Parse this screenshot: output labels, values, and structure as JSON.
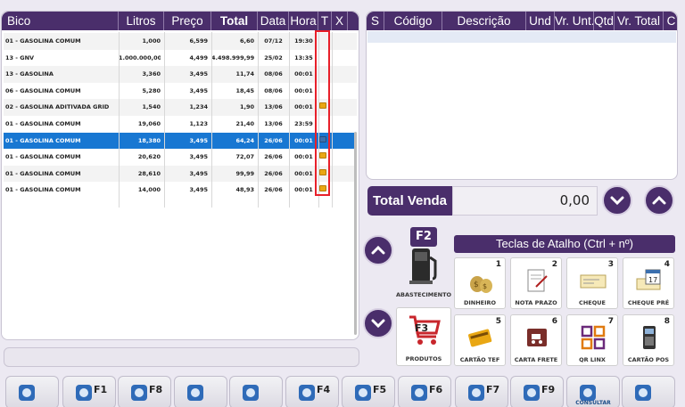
{
  "left_table": {
    "columns": [
      "Bico",
      "Litros",
      "Preço",
      "Total",
      "Data",
      "Hora",
      "T",
      "X"
    ],
    "rows": [
      {
        "bico": "01 - GASOLINA COMUM",
        "litros": "1,000",
        "preco": "6,599",
        "total": "6,60",
        "data": "07/12",
        "hora": "19:30",
        "icon": ""
      },
      {
        "bico": "13 - GNV",
        "litros": "1.000.000,000",
        "preco": "4,499",
        "total": "4.498.999,99",
        "data": "25/02",
        "hora": "13:35",
        "icon": ""
      },
      {
        "bico": "13 - GASOLINA",
        "litros": "3,360",
        "preco": "3,495",
        "total": "11,74",
        "data": "08/06",
        "hora": "00:01",
        "icon": ""
      },
      {
        "bico": "06 - GASOLINA COMUM",
        "litros": "5,280",
        "preco": "3,495",
        "total": "18,45",
        "data": "08/06",
        "hora": "00:01",
        "icon": ""
      },
      {
        "bico": "02 - GASOLINA ADITIVADA GRID",
        "litros": "1,540",
        "preco": "1,234",
        "total": "1,90",
        "data": "13/06",
        "hora": "00:01",
        "icon": "yellow"
      },
      {
        "bico": "01 - GASOLINA COMUM",
        "litros": "19,060",
        "preco": "1,123",
        "total": "21,40",
        "data": "13/06",
        "hora": "23:59",
        "icon": ""
      },
      {
        "bico": "01 - GASOLINA COMUM",
        "litros": "18,380",
        "preco": "3,495",
        "total": "64,24",
        "data": "26/06",
        "hora": "00:01",
        "icon": "blue",
        "selected": true
      },
      {
        "bico": "01 - GASOLINA COMUM",
        "litros": "20,620",
        "preco": "3,495",
        "total": "72,07",
        "data": "26/06",
        "hora": "00:01",
        "icon": "yellow"
      },
      {
        "bico": "01 - GASOLINA COMUM",
        "litros": "28,610",
        "preco": "3,495",
        "total": "99,99",
        "data": "26/06",
        "hora": "00:01",
        "icon": "yellow"
      },
      {
        "bico": "01 - GASOLINA COMUM",
        "litros": "14,000",
        "preco": "3,495",
        "total": "48,93",
        "data": "26/06",
        "hora": "00:01",
        "icon": "yellow"
      }
    ]
  },
  "right_table": {
    "columns": [
      "S",
      "Código",
      "Descrição",
      "Und",
      "Vr. Unt.",
      "Qtd",
      "Vr. Total",
      "C"
    ]
  },
  "total_venda": {
    "label": "Total Venda",
    "value": "0,00"
  },
  "shortcuts": {
    "title": "Teclas de Atalho (Ctrl + nº)",
    "f2_key": "F2",
    "f2_label": "ABASTECIMENTO",
    "f3_key": "F3",
    "f3_label": "PRODUTOS",
    "tiles": [
      {
        "num": "1",
        "label": "DINHEIRO",
        "icon": "money-bags-icon"
      },
      {
        "num": "2",
        "label": "NOTA PRAZO",
        "icon": "note-icon"
      },
      {
        "num": "3",
        "label": "CHEQUE",
        "icon": "cheque-icon"
      },
      {
        "num": "4",
        "label": "CHEQUE PRÉ",
        "icon": "calendar-cheque-icon"
      },
      {
        "num": "5",
        "label": "CARTÃO TEF",
        "icon": "card-icon"
      },
      {
        "num": "6",
        "label": "CARTA FRETE",
        "icon": "truck-icon"
      },
      {
        "num": "7",
        "label": "QR LINX",
        "icon": "qr-icon"
      },
      {
        "num": "8",
        "label": "CARTÃO POS",
        "icon": "pos-icon"
      }
    ]
  },
  "bottom_toolbar": [
    {
      "key": "",
      "caption": "",
      "icon": "fuel-nozzle-icon"
    },
    {
      "key": "F1",
      "caption": "",
      "icon": "fuel-nozzle-icon"
    },
    {
      "key": "F8",
      "caption": "",
      "icon": "fuel-can-icon"
    },
    {
      "key": "",
      "caption": "",
      "icon": "printer-icon"
    },
    {
      "key": "",
      "caption": "",
      "icon": "clock-icon"
    },
    {
      "key": "F4",
      "caption": "",
      "icon": "money-icon"
    },
    {
      "key": "F5",
      "caption": "",
      "icon": "users-icon"
    },
    {
      "key": "F6",
      "caption": "",
      "icon": "cancel-printer-icon"
    },
    {
      "key": "F7",
      "caption": "",
      "icon": "search-doc-icon"
    },
    {
      "key": "F9",
      "caption": "",
      "icon": "cancel-box-icon"
    },
    {
      "key": "",
      "caption": "CONSULTAR",
      "icon": "magnifier-icon"
    },
    {
      "key": "",
      "caption": "",
      "icon": "user-computer-icon"
    }
  ],
  "colors": {
    "header": "#4a2e6b",
    "selected_row": "#1877d2",
    "highlight_border": "#e8202a"
  }
}
